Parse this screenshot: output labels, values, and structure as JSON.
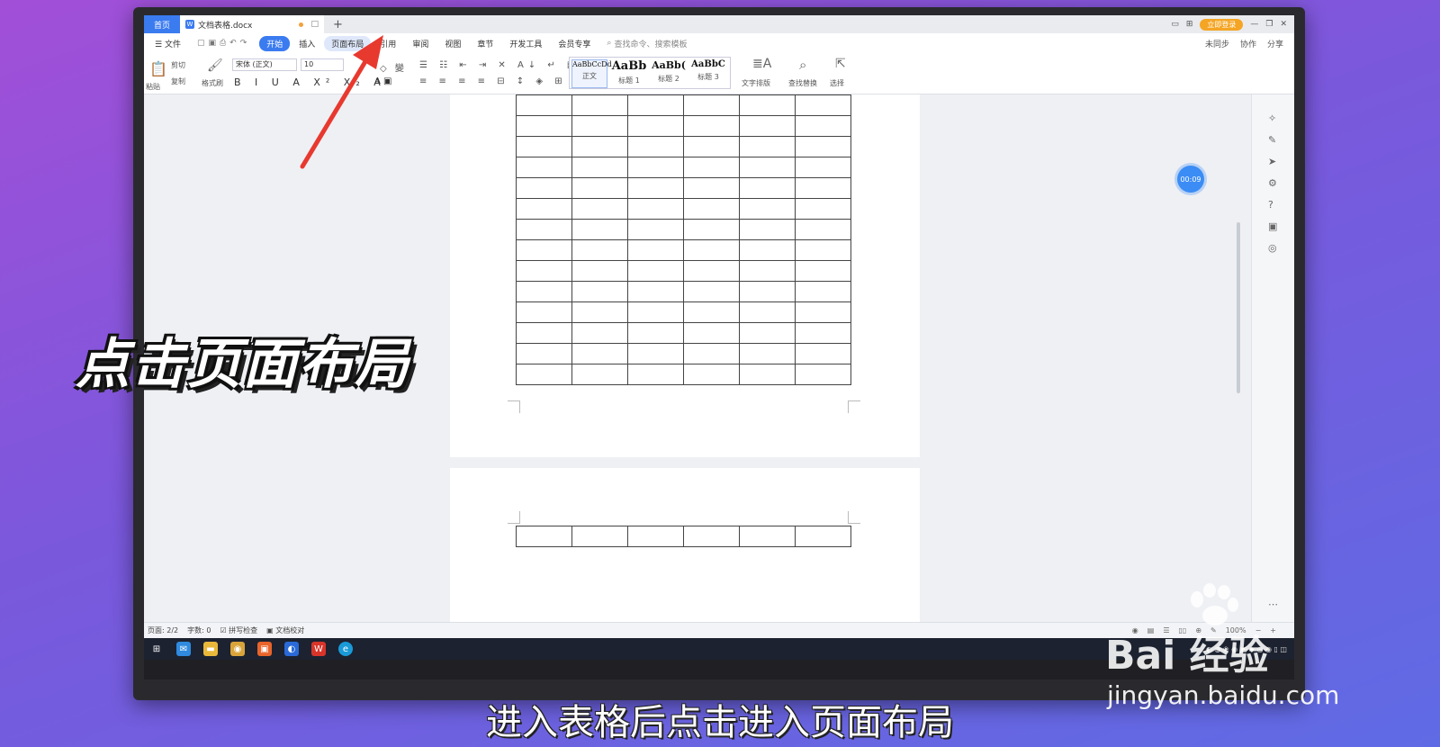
{
  "titlebar": {
    "home_tab": "首页",
    "doc_tab": "文档表格.docx",
    "login_button": "立即登录"
  },
  "menubar": {
    "file": "文件",
    "items": [
      "开始",
      "插入",
      "页面布局",
      "引用",
      "审阅",
      "视图",
      "章节",
      "开发工具",
      "会员专享"
    ],
    "search_placeholder": "查找命令、搜索模板",
    "right_items": [
      "未同步",
      "协作",
      "分享"
    ]
  },
  "ribbon": {
    "clipboard": [
      "剪切",
      "复制",
      "格式刷",
      "粘贴"
    ],
    "font_name": "宋体 (正文)",
    "font_size": "10",
    "styles": [
      {
        "sample": "AaBbCcDd",
        "label": "正文"
      },
      {
        "sample": "AaBb",
        "label": "标题 1"
      },
      {
        "sample": "AaBb(",
        "label": "标题 2"
      },
      {
        "sample": "AaBbC",
        "label": "标题 3"
      }
    ],
    "text_layout": "文字排版",
    "find_replace": "查找替换",
    "select": "选择"
  },
  "document": {
    "page1_rows": 14,
    "page2_rows": 1,
    "cols": 6
  },
  "timer": "00:09",
  "statusbar": {
    "page": "页面: 2/2",
    "words": "字数: 0",
    "spellcheck": "拼写检查",
    "proofread": "文档校对",
    "zoom": "100%"
  },
  "overlay": {
    "callout": "点击页面布局",
    "subtitle": "进入表格后点击进入页面布局"
  },
  "watermark": {
    "logo": "Bai  经验",
    "url": "jingyan.baidu.com"
  },
  "colors": {
    "accent": "#3b7bf0",
    "arrow": "#e8392f"
  }
}
